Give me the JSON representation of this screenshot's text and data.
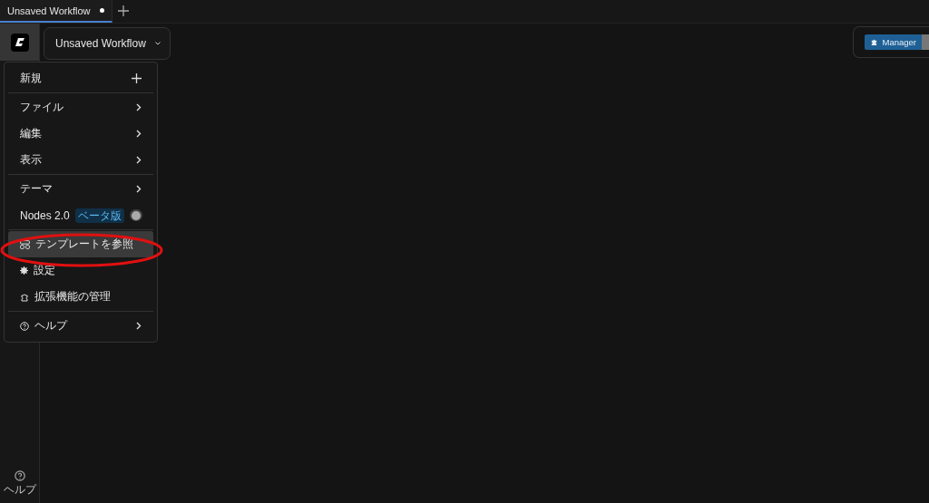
{
  "tabs": [
    {
      "label": "Unsaved Workflow",
      "selected": true,
      "modified": true
    }
  ],
  "workflow_button": {
    "label": "Unsaved Workflow"
  },
  "menu": {
    "sections": [
      {
        "items": [
          {
            "kind": "plus",
            "label": "新規",
            "highlighted": false
          }
        ]
      },
      {
        "items": [
          {
            "kind": "submenu",
            "label": "ファイル",
            "highlighted": false
          },
          {
            "kind": "submenu",
            "label": "編集",
            "highlighted": false
          },
          {
            "kind": "submenu",
            "label": "表示",
            "highlighted": false
          }
        ]
      },
      {
        "items": [
          {
            "kind": "submenu",
            "label": "テーマ",
            "highlighted": false
          },
          {
            "kind": "toggle",
            "label": "Nodes 2.0",
            "badge": "ベータ版",
            "on": false,
            "highlighted": false
          }
        ]
      },
      {
        "items": [
          {
            "kind": "templates",
            "label": "テンプレートを参照",
            "highlighted": true
          },
          {
            "kind": "settings",
            "label": "設定",
            "highlighted": false
          },
          {
            "kind": "extensions",
            "label": "拡張機能の管理",
            "highlighted": false
          }
        ]
      },
      {
        "items": [
          {
            "kind": "help",
            "label": "ヘルプ",
            "highlighted": false
          }
        ]
      }
    ]
  },
  "sidebar": {
    "help_label": "ヘルプ"
  },
  "toolbar": {
    "manager_label": "Manager"
  }
}
